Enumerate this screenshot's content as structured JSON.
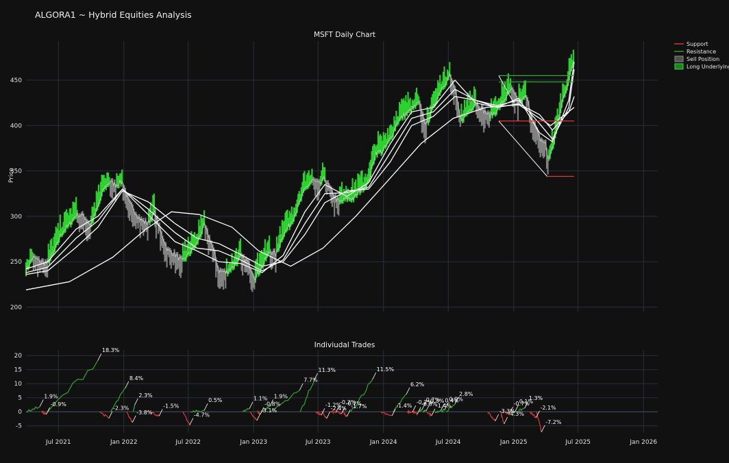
{
  "app_title": "ALGORA1 ~ Hybrid Equities Analysis",
  "colors": {
    "background": "#111111",
    "grid": "#2a2f3a",
    "support": "#e03a2e",
    "resistance": "#2fa82f",
    "long_fill": "#2fe02f",
    "sell_fill": "#8a8a8a",
    "ma": "#ffffff"
  },
  "legend": [
    {
      "label": "Support",
      "kind": "line",
      "color": "#e03a2e"
    },
    {
      "label": "Resistance",
      "kind": "line",
      "color": "#2fa82f"
    },
    {
      "label": "Sell Position",
      "kind": "box",
      "color": "#8a8a8a"
    },
    {
      "label": "Long Underlying",
      "kind": "box",
      "color": "#2fe02f"
    }
  ],
  "chart_data": [
    {
      "type": "line",
      "title": "MSFT Daily Chart",
      "ylabel": "Price",
      "xlabel": "",
      "ylim": [
        195,
        493
      ],
      "yticks": [
        200,
        250,
        300,
        350,
        400,
        450
      ],
      "grid": true,
      "legend_position": "top-right",
      "price": {
        "dates": [
          "2021-04-01",
          "2021-04-20",
          "2021-05-12",
          "2021-06-01",
          "2021-06-20",
          "2021-07-10",
          "2021-07-30",
          "2021-08-20",
          "2021-09-10",
          "2021-09-30",
          "2021-10-20",
          "2021-11-05",
          "2021-11-22",
          "2021-12-10",
          "2021-12-28",
          "2022-01-15",
          "2022-02-01",
          "2022-02-20",
          "2022-03-10",
          "2022-03-29",
          "2022-04-15",
          "2022-05-05",
          "2022-05-25",
          "2022-06-15",
          "2022-07-05",
          "2022-07-25",
          "2022-08-15",
          "2022-09-05",
          "2022-09-25",
          "2022-10-15",
          "2022-11-05",
          "2022-11-25",
          "2022-12-15",
          "2023-01-05",
          "2023-01-25",
          "2023-02-15",
          "2023-03-05",
          "2023-03-25",
          "2023-04-15",
          "2023-05-05",
          "2023-05-25",
          "2023-06-15",
          "2023-07-05",
          "2023-07-20",
          "2023-08-10",
          "2023-08-30",
          "2023-09-20",
          "2023-10-10",
          "2023-10-30",
          "2023-11-20",
          "2023-12-10",
          "2023-12-30",
          "2024-01-20",
          "2024-02-10",
          "2024-03-01",
          "2024-03-20",
          "2024-04-10",
          "2024-04-30",
          "2024-05-20",
          "2024-06-10",
          "2024-07-05",
          "2024-07-20",
          "2024-08-05",
          "2024-08-25",
          "2024-09-15",
          "2024-10-05",
          "2024-10-25",
          "2024-11-15",
          "2024-12-05",
          "2024-12-25",
          "2025-01-15",
          "2025-02-05",
          "2025-02-25",
          "2025-03-15",
          "2025-04-01",
          "2025-04-08",
          "2025-04-20",
          "2025-05-05",
          "2025-05-20",
          "2025-06-05",
          "2025-06-20"
        ],
        "close": [
          240,
          255,
          250,
          248,
          262,
          282,
          290,
          302,
          300,
          290,
          310,
          330,
          338,
          335,
          338,
          315,
          305,
          295,
          292,
          305,
          282,
          262,
          258,
          250,
          260,
          270,
          290,
          270,
          240,
          238,
          245,
          255,
          250,
          232,
          245,
          262,
          258,
          280,
          292,
          310,
          330,
          340,
          335,
          342,
          325,
          315,
          320,
          320,
          330,
          338,
          370,
          372,
          385,
          405,
          412,
          418,
          425,
          400,
          420,
          440,
          455,
          440,
          405,
          415,
          425,
          418,
          410,
          417,
          428,
          440,
          425,
          432,
          405,
          385,
          380,
          362,
          375,
          400,
          430,
          450,
          475
        ]
      },
      "moving_averages": [
        {
          "dates": [
            "2021-04-01",
            "2021-06-01",
            "2021-08-20",
            "2021-10-20",
            "2021-12-28",
            "2022-03-10",
            "2022-05-25",
            "2022-07-25",
            "2022-09-25",
            "2022-11-25",
            "2023-01-25",
            "2023-03-25",
            "2023-05-25",
            "2023-07-20",
            "2023-09-20",
            "2023-11-20",
            "2024-01-20",
            "2024-03-20",
            "2024-05-20",
            "2024-07-20",
            "2024-09-15",
            "2024-11-15",
            "2025-01-15",
            "2025-03-15",
            "2025-04-20",
            "2025-06-05",
            "2025-06-20"
          ],
          "values": [
            242,
            250,
            286,
            300,
            330,
            302,
            272,
            262,
            250,
            248,
            238,
            257,
            305,
            335,
            322,
            337,
            380,
            415,
            420,
            450,
            425,
            420,
            430,
            392,
            382,
            428,
            470
          ]
        },
        {
          "dates": [
            "2021-04-01",
            "2021-06-01",
            "2021-08-20",
            "2021-10-20",
            "2021-12-28",
            "2022-03-10",
            "2022-05-25",
            "2022-07-25",
            "2022-09-25",
            "2022-11-25",
            "2023-01-25",
            "2023-03-25",
            "2023-05-25",
            "2023-07-20",
            "2023-09-20",
            "2023-11-20",
            "2024-01-20",
            "2024-03-20",
            "2024-05-20",
            "2024-07-20",
            "2024-09-15",
            "2024-11-15",
            "2025-01-15",
            "2025-03-15",
            "2025-04-20",
            "2025-06-05",
            "2025-06-20"
          ],
          "values": [
            238,
            244,
            276,
            295,
            330,
            308,
            282,
            265,
            262,
            252,
            240,
            252,
            292,
            325,
            326,
            332,
            370,
            408,
            415,
            440,
            428,
            422,
            428,
            402,
            385,
            420,
            462
          ]
        },
        {
          "dates": [
            "2021-04-01",
            "2021-06-01",
            "2021-08-20",
            "2021-10-20",
            "2021-12-28",
            "2022-03-10",
            "2022-05-25",
            "2022-07-25",
            "2022-09-25",
            "2022-11-25",
            "2023-01-25",
            "2023-03-25",
            "2023-05-25",
            "2023-07-20",
            "2023-09-20",
            "2023-11-20",
            "2024-01-20",
            "2024-03-20",
            "2024-05-20",
            "2024-07-20",
            "2024-09-15",
            "2024-11-15",
            "2025-01-15",
            "2025-03-15",
            "2025-04-20",
            "2025-06-05",
            "2025-06-20"
          ],
          "values": [
            236,
            240,
            266,
            288,
            328,
            316,
            292,
            276,
            270,
            258,
            245,
            250,
            280,
            315,
            328,
            330,
            360,
            400,
            410,
            432,
            428,
            420,
            424,
            412,
            395,
            415,
            432
          ]
        },
        {
          "dates": [
            "2021-04-01",
            "2021-08-01",
            "2021-12-01",
            "2022-03-01",
            "2022-05-15",
            "2022-08-01",
            "2022-11-01",
            "2023-01-15",
            "2023-04-15",
            "2023-07-15",
            "2023-10-15",
            "2024-01-15",
            "2024-04-15",
            "2024-07-15",
            "2024-10-15",
            "2025-01-15",
            "2025-04-15",
            "2025-06-20"
          ],
          "values": [
            219,
            228,
            255,
            285,
            305,
            302,
            288,
            262,
            245,
            265,
            300,
            340,
            380,
            408,
            420,
            423,
            400,
            420
          ]
        }
      ],
      "support_lines": [
        {
          "x": [
            "2024-11-20",
            "2025-06-20"
          ],
          "y": [
            405,
            405
          ]
        },
        {
          "x": [
            "2025-04-05",
            "2025-06-20"
          ],
          "y": [
            344,
            344
          ]
        }
      ],
      "resistance_lines": [
        {
          "x": [
            "2024-11-20",
            "2025-06-20"
          ],
          "y": [
            455,
            455
          ]
        },
        {
          "x": [
            "2024-11-20",
            "2025-06-20"
          ],
          "y": [
            448,
            448
          ]
        }
      ],
      "pattern_lines": [
        {
          "x": [
            "2024-11-20",
            "2025-04-05"
          ],
          "y": [
            405,
            344
          ]
        },
        {
          "x": [
            "2024-11-20",
            "2025-01-01"
          ],
          "y": [
            455,
            425
          ]
        }
      ]
    },
    {
      "type": "line",
      "title": "Indiviudal Trades",
      "xlabel": "",
      "ylabel": "",
      "ylim": [
        -7.5,
        22
      ],
      "yticks": [
        -5,
        0,
        5,
        10,
        15,
        20
      ],
      "grid": true,
      "x_ticks": [
        "Jul 2021",
        "Jan 2022",
        "Jul 2022",
        "Jan 2023",
        "Jul 2023",
        "Jan 2024",
        "Jul 2024",
        "Jan 2025",
        "Jul 2025",
        "Jan 2026"
      ],
      "x_tick_dates": [
        "2021-07-01",
        "2022-01-01",
        "2022-07-01",
        "2023-01-01",
        "2023-07-01",
        "2024-01-01",
        "2024-07-01",
        "2025-01-01",
        "2025-07-01",
        "2026-01-01"
      ],
      "x_range": [
        "2021-04-01",
        "2026-02-10"
      ],
      "trades": [
        {
          "start": "2021-04-01",
          "end": "2021-05-10",
          "result": 1.9
        },
        {
          "start": "2021-05-15",
          "end": "2021-05-28",
          "result": -0.9
        },
        {
          "start": "2021-06-01",
          "end": "2021-10-20",
          "result": 18.3
        },
        {
          "start": "2021-10-25",
          "end": "2021-11-20",
          "result": -2.3
        },
        {
          "start": "2021-11-25",
          "end": "2022-01-05",
          "result": 8.4
        },
        {
          "start": "2022-01-08",
          "end": "2022-01-25",
          "result": -3.8
        },
        {
          "start": "2022-01-27",
          "end": "2022-01-31",
          "result": 2.3
        },
        {
          "start": "2022-03-15",
          "end": "2022-04-10",
          "result": -1.5
        },
        {
          "start": "2022-06-15",
          "end": "2022-07-05",
          "result": -4.7
        },
        {
          "start": "2022-07-08",
          "end": "2022-08-15",
          "result": 0.5
        },
        {
          "start": "2022-12-01",
          "end": "2022-12-20",
          "result": 1.1
        },
        {
          "start": "2022-12-22",
          "end": "2023-01-10",
          "result": -3.1
        },
        {
          "start": "2023-01-12",
          "end": "2023-01-20",
          "result": -0.8
        },
        {
          "start": "2023-01-22",
          "end": "2023-02-15",
          "result": 1.9
        },
        {
          "start": "2023-02-18",
          "end": "2023-05-10",
          "result": 7.7
        },
        {
          "start": "2023-05-12",
          "end": "2023-06-20",
          "result": 11.3
        },
        {
          "start": "2023-06-25",
          "end": "2023-07-10",
          "result": -1.2
        },
        {
          "start": "2023-07-12",
          "end": "2023-07-25",
          "result": -2.4
        },
        {
          "start": "2023-08-05",
          "end": "2023-08-20",
          "result": -0.2
        },
        {
          "start": "2023-08-22",
          "end": "2023-09-05",
          "result": -0.7
        },
        {
          "start": "2023-09-08",
          "end": "2023-09-20",
          "result": -1.7
        },
        {
          "start": "2023-10-01",
          "end": "2023-12-01",
          "result": 11.5
        },
        {
          "start": "2023-12-25",
          "end": "2024-01-25",
          "result": -1.4
        },
        {
          "start": "2024-01-28",
          "end": "2024-03-05",
          "result": 6.2
        },
        {
          "start": "2024-03-08",
          "end": "2024-03-22",
          "result": -0.2
        },
        {
          "start": "2024-03-25",
          "end": "2024-04-05",
          "result": -0.8
        },
        {
          "start": "2024-04-08",
          "end": "2024-04-18",
          "result": 0.7
        },
        {
          "start": "2024-04-20",
          "end": "2024-04-30",
          "result": 0.3
        },
        {
          "start": "2024-05-02",
          "end": "2024-05-15",
          "result": -1.4
        },
        {
          "start": "2024-05-25",
          "end": "2024-06-10",
          "result": 0.4
        },
        {
          "start": "2024-06-12",
          "end": "2024-06-22",
          "result": 0.9
        },
        {
          "start": "2024-06-25",
          "end": "2024-07-20",
          "result": 2.8
        },
        {
          "start": "2024-10-20",
          "end": "2024-11-10",
          "result": -3.3
        },
        {
          "start": "2024-11-25",
          "end": "2024-12-05",
          "result": -4.3
        },
        {
          "start": "2024-12-08",
          "end": "2024-12-20",
          "result": -0.7
        },
        {
          "start": "2024-12-23",
          "end": "2025-01-05",
          "result": 0.1
        },
        {
          "start": "2025-01-08",
          "end": "2025-02-01",
          "result": 1.3
        },
        {
          "start": "2025-02-15",
          "end": "2025-03-05",
          "result": -2.1
        },
        {
          "start": "2025-03-06",
          "end": "2025-03-20",
          "result": -7.2
        }
      ],
      "annotations": [
        {
          "label": "1.9%",
          "date": "2021-05-10",
          "value": 1.9
        },
        {
          "label": "-0.9%",
          "date": "2021-05-28",
          "value": -0.9
        },
        {
          "label": "18.3%",
          "date": "2021-10-20",
          "value": 18.3
        },
        {
          "label": "-2.3%",
          "date": "2021-11-20",
          "value": -2.3
        },
        {
          "label": "8.4%",
          "date": "2022-01-05",
          "value": 8.4
        },
        {
          "label": "2.3%",
          "date": "2022-01-31",
          "value": 2.3
        },
        {
          "label": "-3.8%",
          "date": "2022-01-25",
          "value": -3.8
        },
        {
          "label": "-1.5%",
          "date": "2022-04-10",
          "value": -1.5
        },
        {
          "label": "-4.7%",
          "date": "2022-07-05",
          "value": -4.7
        },
        {
          "label": "0.5%",
          "date": "2022-08-15",
          "value": 0.5
        },
        {
          "label": "1.1%",
          "date": "2022-12-20",
          "value": 1.1
        },
        {
          "label": "-3.1%",
          "date": "2023-01-10",
          "value": -3.1
        },
        {
          "label": "-0.8%",
          "date": "2023-01-20",
          "value": -0.8
        },
        {
          "label": "1.9%",
          "date": "2023-02-15",
          "value": 1.9
        },
        {
          "label": "7.7%",
          "date": "2023-05-10",
          "value": 7.7
        },
        {
          "label": "11.3%",
          "date": "2023-06-20",
          "value": 11.3
        },
        {
          "label": "-1.2%",
          "date": "2023-07-10",
          "value": -1.2
        },
        {
          "label": "-2.4%",
          "date": "2023-07-25",
          "value": -2.4
        },
        {
          "label": "-0.2%",
          "date": "2023-08-20",
          "value": -0.2
        },
        {
          "label": "-0.7%",
          "date": "2023-09-05",
          "value": -0.7
        },
        {
          "label": "-1.7%",
          "date": "2023-09-20",
          "value": -1.7
        },
        {
          "label": "11.5%",
          "date": "2023-12-01",
          "value": 11.5
        },
        {
          "label": "-1.4%",
          "date": "2024-01-25",
          "value": -1.4
        },
        {
          "label": "6.2%",
          "date": "2024-03-05",
          "value": 6.2
        },
        {
          "label": "-0.2%",
          "date": "2024-03-22",
          "value": -0.2
        },
        {
          "label": "-0.8%",
          "date": "2024-04-05",
          "value": -0.8
        },
        {
          "label": "0.7%",
          "date": "2024-04-18",
          "value": 0.7
        },
        {
          "label": "0.3%",
          "date": "2024-04-30",
          "value": 0.3
        },
        {
          "label": "-1.4%",
          "date": "2024-05-15",
          "value": -1.4
        },
        {
          "label": "0.4%",
          "date": "2024-06-10",
          "value": 0.4
        },
        {
          "label": "0.9%",
          "date": "2024-06-22",
          "value": 0.9
        },
        {
          "label": "2.8%",
          "date": "2024-07-20",
          "value": 2.8
        },
        {
          "label": "-3.3%",
          "date": "2024-11-10",
          "value": -3.3
        },
        {
          "label": "-4.3%",
          "date": "2024-12-05",
          "value": -4.3
        },
        {
          "label": "-0.7%",
          "date": "2024-12-20",
          "value": -0.7
        },
        {
          "label": "0.1%",
          "date": "2025-01-05",
          "value": 0.1
        },
        {
          "label": "1.3%",
          "date": "2025-02-01",
          "value": 1.3
        },
        {
          "label": "-2.1%",
          "date": "2025-03-05",
          "value": -2.1
        },
        {
          "label": "-7.2%",
          "date": "2025-03-20",
          "value": -7.2
        }
      ]
    }
  ]
}
